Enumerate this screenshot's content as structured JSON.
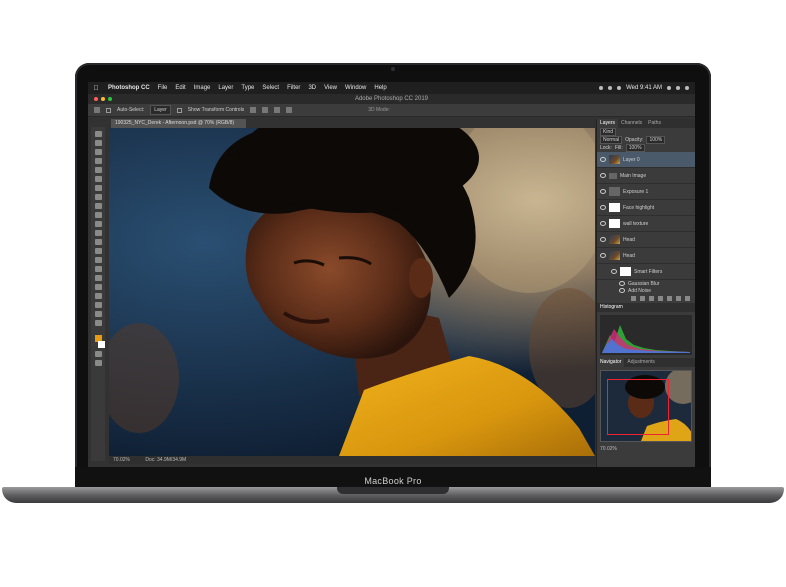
{
  "device": {
    "brand_label": "MacBook Pro"
  },
  "menubar": {
    "app_name": "Photoshop CC",
    "items": [
      "File",
      "Edit",
      "Image",
      "Layer",
      "Type",
      "Select",
      "Filter",
      "3D",
      "View",
      "Window",
      "Help"
    ],
    "clock": "Wed 9:41 AM"
  },
  "window": {
    "title": "Adobe Photoshop CC 2019"
  },
  "options_bar": {
    "auto_select_label": "Auto-Select:",
    "auto_select_value": "Layer",
    "transform_label": "Show Transform Controls",
    "mode_label": "3D Mode:"
  },
  "document": {
    "tab_title": "190325_NYC_Derek - Afternoon.psd @ 70% (RGB/8)",
    "zoom": "70.02%",
    "doc_size": "Doc: 34.9M/34.9M"
  },
  "layers_panel": {
    "tabs": [
      "Layers",
      "Channels",
      "Paths"
    ],
    "search_kind": "Kind",
    "blend_mode": "Normal",
    "opacity_label": "Opacity:",
    "opacity_value": "100%",
    "lock_label": "Lock:",
    "fill_label": "Fill:",
    "fill_value": "100%",
    "layers": [
      {
        "name": "Layer 0"
      },
      {
        "name": "Main Image"
      },
      {
        "name": "Exposure 1"
      },
      {
        "name": "Face highlight"
      },
      {
        "name": "wall texture"
      },
      {
        "name": "Head"
      },
      {
        "name": "Head"
      },
      {
        "name": "Smart Filters"
      }
    ],
    "sub_items": [
      "Gaussian Blur",
      "Add Noise"
    ]
  },
  "histogram_panel": {
    "title": "Histogram"
  },
  "navigator_panel": {
    "tabs": [
      "Navigator",
      "Adjustments"
    ],
    "zoom": "70.02%"
  }
}
